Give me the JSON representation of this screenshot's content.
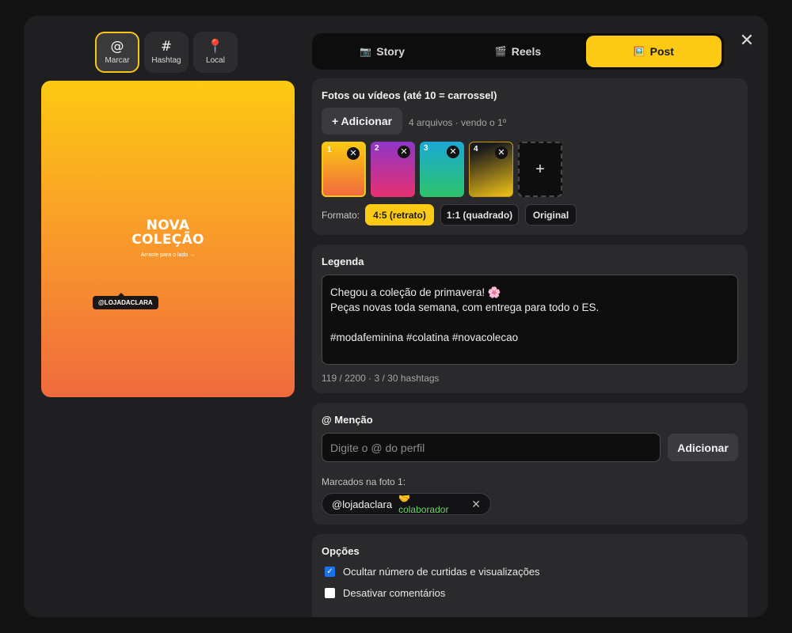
{
  "close_label": "✕",
  "tools": [
    {
      "icon": "@",
      "label": "Marcar"
    },
    {
      "icon": "#",
      "label": "Hashtag"
    },
    {
      "icon": "📍",
      "label": "Local"
    }
  ],
  "preview": {
    "title_line1": "NOVA",
    "title_line2": "COLEÇÃO",
    "subtitle": "Arraste para o lado →",
    "tag": "@LOJADACLARA"
  },
  "tabs": [
    {
      "icon": "📷",
      "label": "Story"
    },
    {
      "icon": "🎬",
      "label": "Reels"
    },
    {
      "icon": "🖼️",
      "label": "Post"
    }
  ],
  "media": {
    "title": "Fotos ou vídeos (até 10 = carrossel)",
    "add_label": "+ Adicionar",
    "info": "4 arquivos · vendo o 1º",
    "thumbs": [
      "1",
      "2",
      "3",
      "4"
    ],
    "remove_glyph": "✕",
    "add_thumb_glyph": "+",
    "format_label": "Formato:",
    "formats": [
      "4:5 (retrato)",
      "1:1 (quadrado)",
      "Original"
    ]
  },
  "caption": {
    "title": "Legenda",
    "text": "Chegou a coleção de primavera! 🌸\nPeças novas toda semana, com entrega para todo o ES.\n\n#modafeminina #colatina #novacolecao",
    "counter": "119 / 2200 · 3 / 30 hashtags"
  },
  "mention": {
    "title": "@ Menção",
    "placeholder": "Digite o @ do perfil",
    "add_label": "Adicionar",
    "tagged_label": "Marcados na foto 1:",
    "tagged_user": "@lojadaclara",
    "tagged_role": "🤝 colaborador",
    "remove_glyph": "✕"
  },
  "options": {
    "title": "Opções",
    "items": [
      {
        "label": "Ocultar número de curtidas e visualizações",
        "checked": true
      },
      {
        "label": "Desativar comentários",
        "checked": false
      }
    ]
  },
  "accent_color": "#fcc915"
}
